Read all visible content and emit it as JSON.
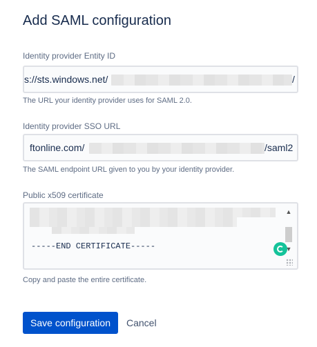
{
  "page": {
    "title": "Add SAML configuration"
  },
  "entity_id": {
    "label": "Identity provider Entity ID",
    "value_prefix": "s://sts.windows.net/",
    "value_suffix": "/",
    "help": "The URL your identity provider uses for SAML 2.0."
  },
  "sso_url": {
    "label": "Identity provider SSO URL",
    "value_prefix": "ftonline.com/",
    "value_suffix": "/saml2",
    "help": "The SAML endpoint URL given to you by your identity provider."
  },
  "certificate": {
    "label": "Public x509 certificate",
    "end_line": "-----END CERTIFICATE-----",
    "help": "Copy and paste the entire certificate."
  },
  "actions": {
    "save_label": "Save configuration",
    "cancel_label": "Cancel"
  },
  "colors": {
    "primary": "#0052cc",
    "grammarly": "#15c39a",
    "text": "#172b4d",
    "muted": "#5e6c84"
  }
}
